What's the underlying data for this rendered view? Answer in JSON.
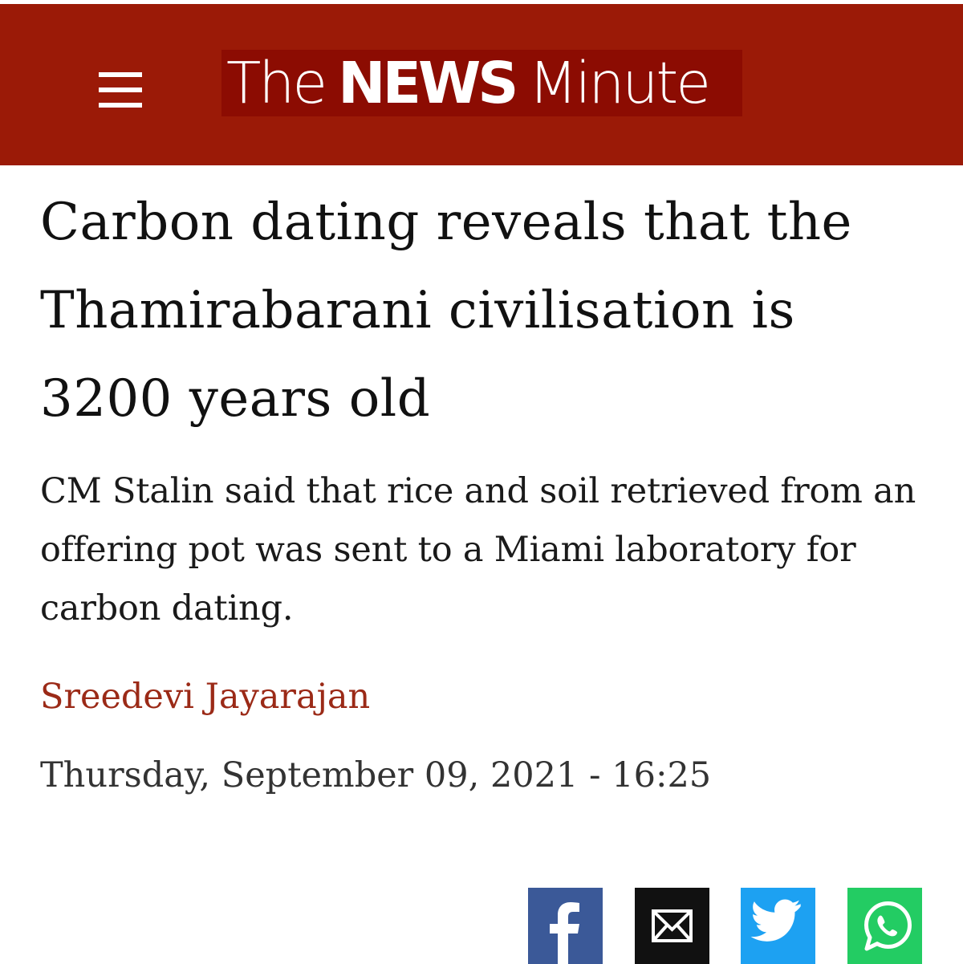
{
  "header": {
    "background_color": "#9b1a07",
    "menu_icon": "hamburger-menu-icon",
    "logo": {
      "word1": "The",
      "word2": "NEWS",
      "word3": "Minute"
    }
  },
  "article": {
    "headline": "Carbon dating reveals that the Thamirabarani civilisation is 3200 years old",
    "summary": "CM Stalin said that rice and soil retrieved from an offering pot was sent to a Miami laboratory for carbon dating.",
    "author": "Sreedevi Jayarajan",
    "author_color": "#9b2a17",
    "datetime": "Thursday, September 09, 2021 - 16:25"
  },
  "share_buttons": [
    {
      "icon": "facebook-icon",
      "color": "#3b5998"
    },
    {
      "icon": "email-icon",
      "color": "#111111"
    },
    {
      "icon": "twitter-icon",
      "color": "#1da1f2"
    },
    {
      "icon": "whatsapp-icon",
      "color": "#23cc63"
    }
  ]
}
